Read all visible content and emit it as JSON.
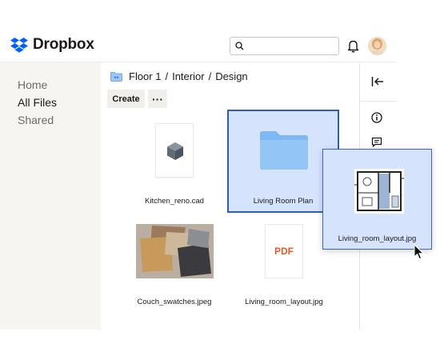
{
  "brand": {
    "name": "Dropbox"
  },
  "header": {
    "search": {
      "placeholder": "",
      "value": ""
    },
    "icons": [
      "search-icon",
      "bell-icon"
    ]
  },
  "sidebar": {
    "items": [
      {
        "label": "Home",
        "active": false
      },
      {
        "label": "All Files",
        "active": true
      },
      {
        "label": "Shared",
        "active": false
      }
    ]
  },
  "breadcrumb": {
    "root": "Floor 1",
    "separator": "/",
    "items": [
      "Interior",
      "Design"
    ]
  },
  "toolbar": {
    "create_label": "Create",
    "more_label": "···"
  },
  "files": [
    {
      "name": "Kitchen_reno.cad",
      "type": "cad"
    },
    {
      "name": "Living Room Plan",
      "type": "folder",
      "selected": true
    },
    {
      "name": "Couch_swatches.jpeg",
      "type": "image"
    },
    {
      "name": "Living_room_layout.jpg",
      "type": "pdf",
      "thumb_label": "PDF"
    }
  ],
  "dragging": {
    "name": "Living_room_layout.jpg",
    "type": "image"
  },
  "colors": {
    "brand": "#0061fe",
    "selection": "#d6e3fd",
    "selection_border": "#2c5fae",
    "folder": "#7eb8f4",
    "sidebar_bg": "#f7f5f2",
    "pdf": "#e05a2b"
  }
}
